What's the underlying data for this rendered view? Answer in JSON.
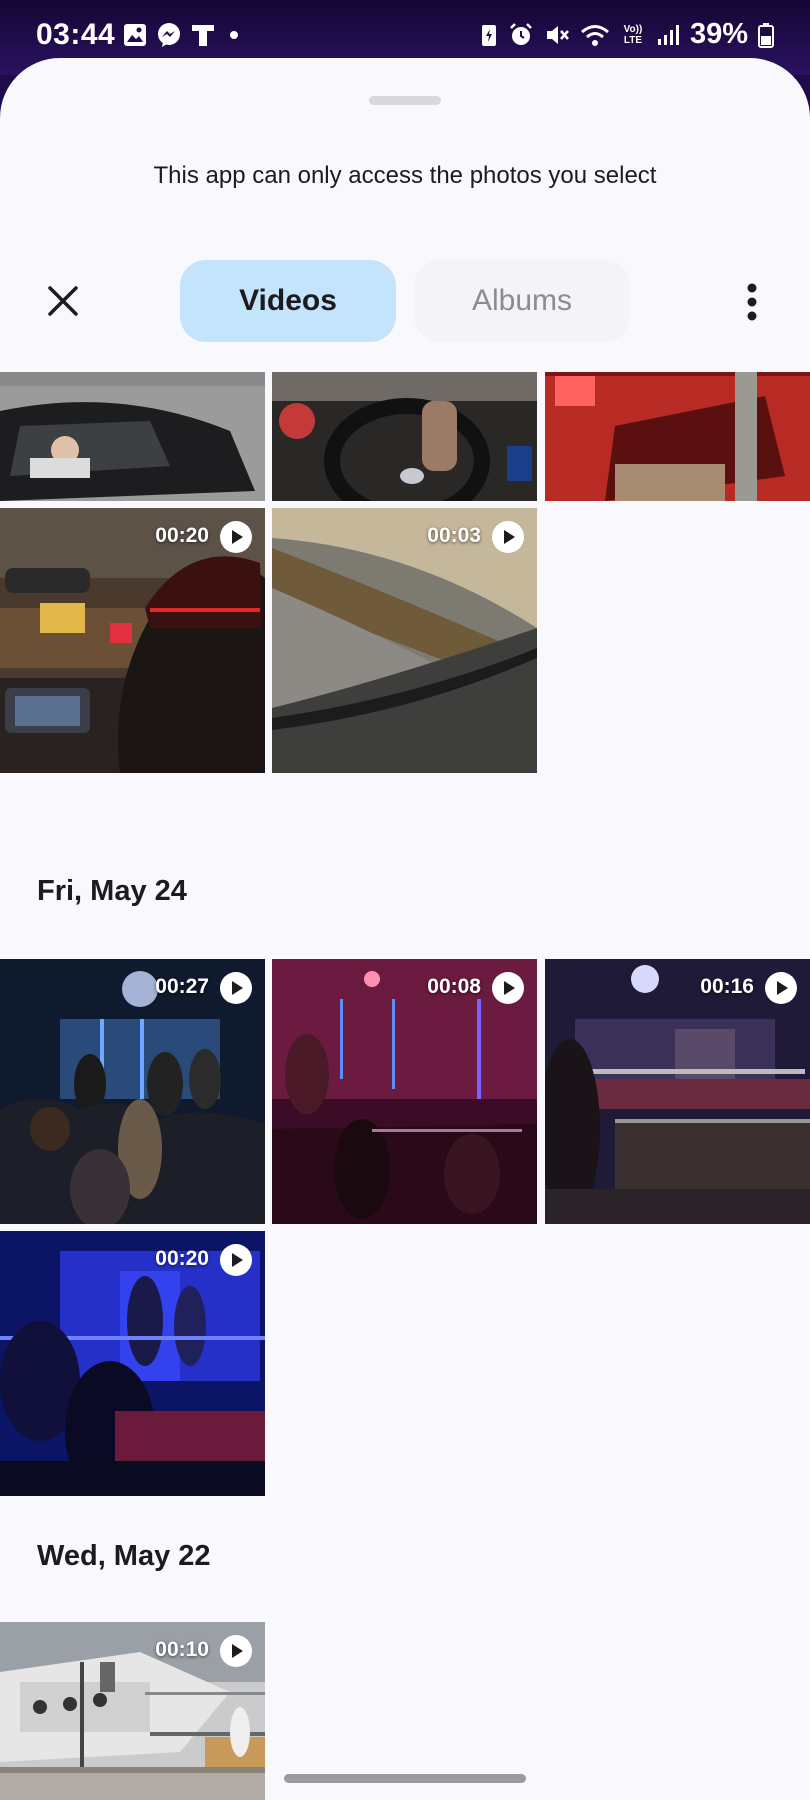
{
  "status_bar": {
    "time": "03:44",
    "battery_percent": "39%",
    "left_icons": [
      "gallery-icon",
      "messenger-icon",
      "t-app-icon",
      "dot-icon"
    ],
    "right_icons": [
      "battery-saver-icon",
      "alarm-icon",
      "mute-icon",
      "wifi-icon",
      "volte-icon",
      "signal-icon",
      "battery-icon"
    ],
    "volte_label": "Vo)) LTE"
  },
  "sheet": {
    "title": "This app can only access the photos you select",
    "tabs": [
      {
        "label": "Videos",
        "selected": true
      },
      {
        "label": "Albums",
        "selected": false
      }
    ],
    "close_icon": "close-icon",
    "more_icon": "more-vertical-icon"
  },
  "sections": [
    {
      "date": "",
      "items": [
        {
          "duration": "",
          "scene": "car-street",
          "partial": true
        },
        {
          "duration": "",
          "scene": "steering-wheel",
          "partial": true
        },
        {
          "duration": "",
          "scene": "red-car-interior",
          "partial": true
        },
        {
          "duration": "00:20",
          "scene": "night-road"
        },
        {
          "duration": "00:03",
          "scene": "blurred-road"
        }
      ]
    },
    {
      "date": "Fri, May 24",
      "items": [
        {
          "duration": "00:27",
          "scene": "concert-blue"
        },
        {
          "duration": "00:08",
          "scene": "concert-red"
        },
        {
          "duration": "00:16",
          "scene": "concert-stage"
        },
        {
          "duration": "00:20",
          "scene": "concert-purple"
        }
      ]
    },
    {
      "date": "Wed, May 22",
      "items": [
        {
          "duration": "00:10",
          "scene": "boat-harbor"
        }
      ]
    }
  ],
  "colors": {
    "sheet_bg": "#f8f8fd",
    "selected_tab_bg": "#c4e4fb",
    "status_bar_bg": "#1f0a4a"
  }
}
